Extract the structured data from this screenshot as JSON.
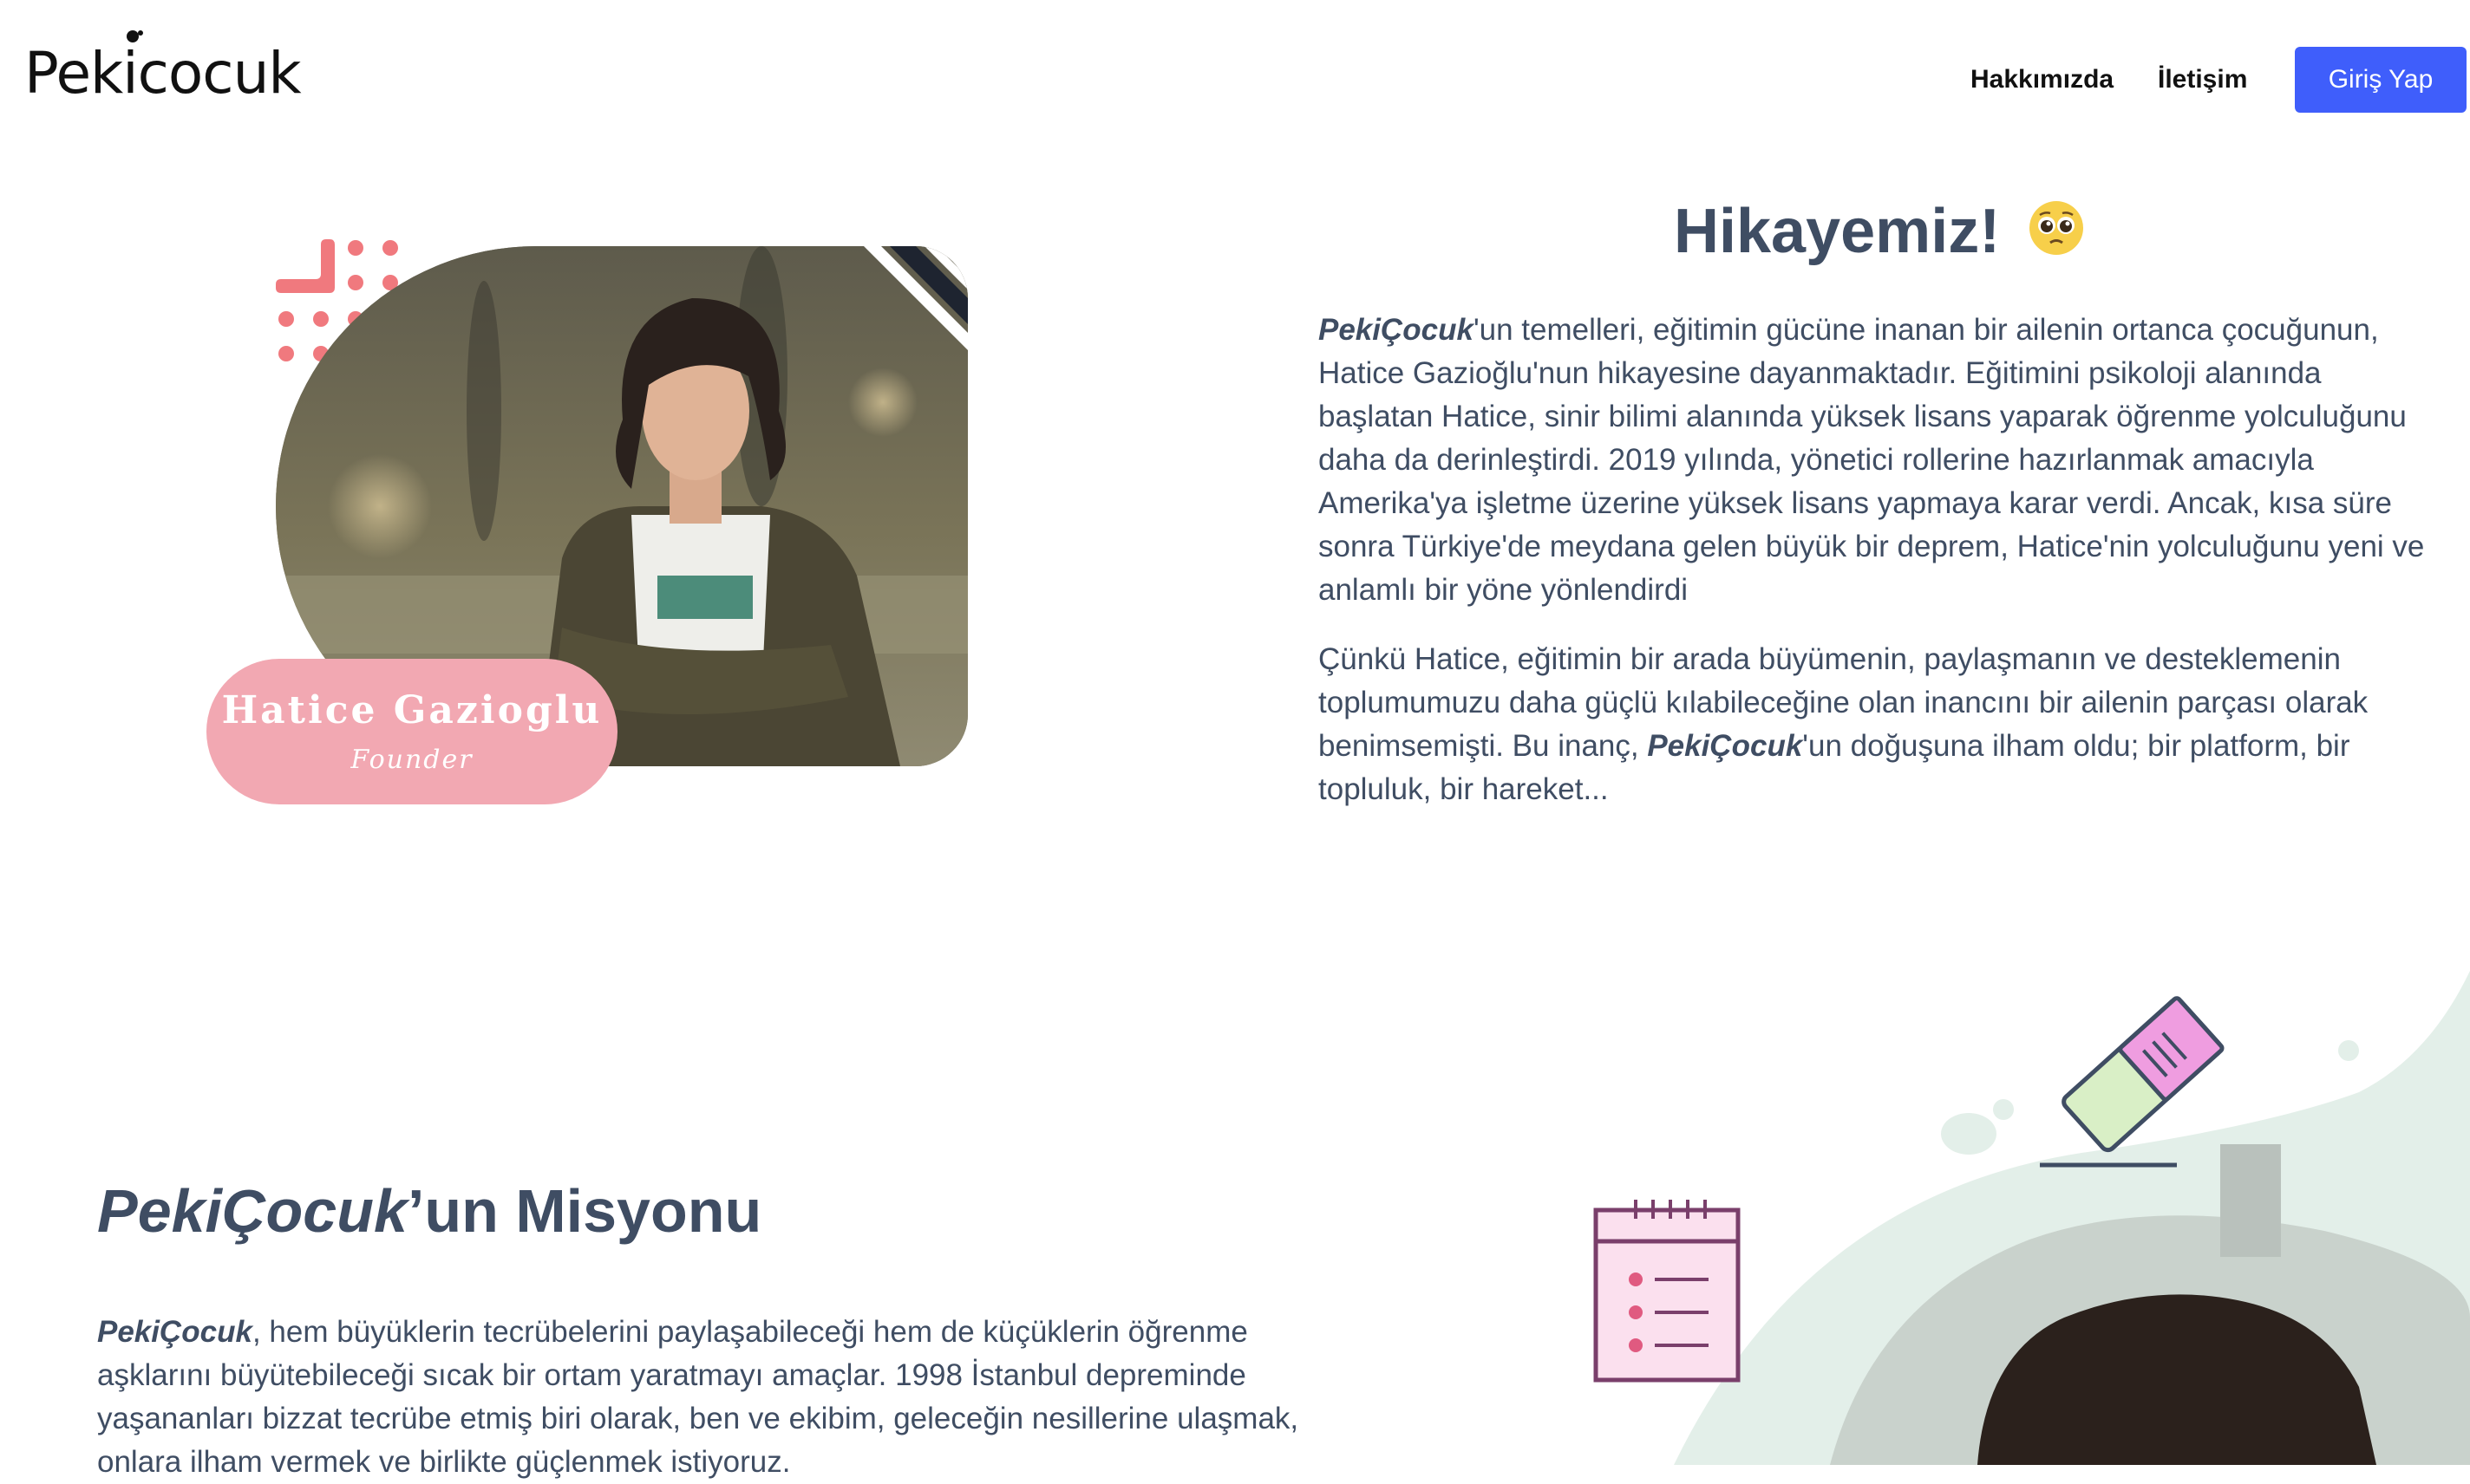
{
  "header": {
    "logo_text": "Pekicocuk",
    "nav": [
      {
        "label": "Hakkımızda"
      },
      {
        "label": "İletişim"
      }
    ],
    "login_label": "Giriş Yap",
    "accent_color": "#3f5efb"
  },
  "story": {
    "title": "Hikayemiz!",
    "title_emoji_icon": "pleading-face-icon",
    "p1_brand": "PekiÇocuk",
    "p1_rest": "'un temelleri, eğitimin gücüne inanan bir ailenin ortanca çocuğunun, Hatice Gazioğlu'nun hikayesine dayanmaktadır. Eğitimini psikoloji alanında başlatan Hatice, sinir bilimi alanında yüksek lisans yaparak öğrenme yolculuğunu daha da derinleştirdi. 2019 yılında, yönetici rollerine hazırlanmak amacıyla Amerika'ya işletme üzerine yüksek lisans yapmaya karar verdi. Ancak, kısa süre sonra Türkiye'de meydana gelen büyük bir deprem, Hatice'nin yolculuğunu yeni ve anlamlı bir yöne yönlendirdi",
    "p2_start": "Çünkü Hatice, eğitimin bir arada büyümenin, paylaşmanın ve desteklemenin toplumumuzu daha güçlü kılabileceğine olan inancını bir ailenin parçası olarak benimsemişti. Bu inanç, ",
    "p2_brand": "PekiÇocuk",
    "p2_end": "'un doğuşuna ilham oldu; bir platform, bir topluluk, bir hareket..."
  },
  "founder": {
    "name": "Hatice Gazioglu",
    "role": "Founder",
    "pill_color": "#f2a8b2",
    "dots_color": "#f0797e"
  },
  "mission": {
    "title_brand": "PekiÇocuk",
    "title_rest": "’un Misyonu",
    "body_brand": "PekiÇocuk",
    "body_rest": ", hem büyüklerin tecrübelerini paylaşabileceği hem de küçüklerin öğrenme aşklarını büyütebileceği sıcak bir ortam yaratmayı amaçlar. 1998 İstanbul depreminde yaşananları bizzat tecrübe etmiş biri olarak, ben ve ekibim, geleceğin nesillerine ulaşmak, onlara ilham vermek ve birlikte güçlenmek istiyoruz."
  }
}
